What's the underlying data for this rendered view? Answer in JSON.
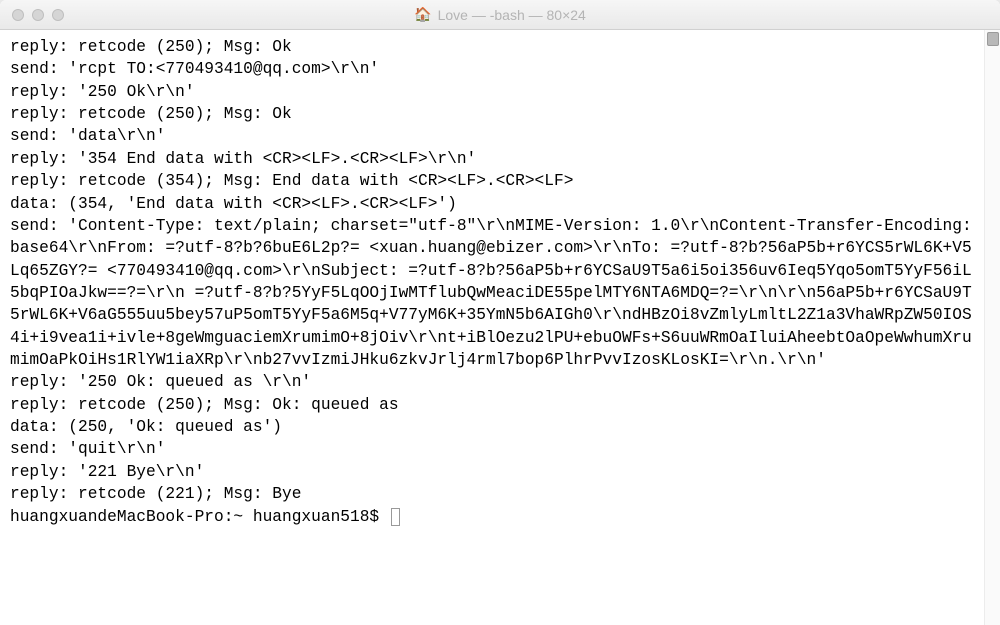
{
  "window": {
    "title": "Love — -bash — 80×24",
    "home_icon": "🏠"
  },
  "terminal": {
    "lines": [
      "reply: retcode (250); Msg: Ok",
      "send: 'rcpt TO:<770493410@qq.com>\\r\\n'",
      "reply: '250 Ok\\r\\n'",
      "reply: retcode (250); Msg: Ok",
      "send: 'data\\r\\n'",
      "reply: '354 End data with <CR><LF>.<CR><LF>\\r\\n'",
      "reply: retcode (354); Msg: End data with <CR><LF>.<CR><LF>",
      "data: (354, 'End data with <CR><LF>.<CR><LF>')",
      "send: 'Content-Type: text/plain; charset=\"utf-8\"\\r\\nMIME-Version: 1.0\\r\\nContent-Transfer-Encoding: base64\\r\\nFrom: =?utf-8?b?6buE6L2p?= <xuan.huang@ebizer.com>\\r\\nTo: =?utf-8?b?56aP5b+r6YCS5rWL6K+V5Lq65ZGY?= <770493410@qq.com>\\r\\nSubject: =?utf-8?b?56aP5b+r6YCSaU9T5a6i5oi356uv6Ieq5Yqo5omT5YyF56iL5bqPIOaJkw==?=\\r\\n =?utf-8?b?5YyF5LqOOjIwMTflubQwMeaciDE55pelMTY6NTA6MDQ=?=\\r\\n\\r\\n56aP5b+r6YCSaU9T5rWL6K+V6aG555uu5bey57uP5omT5YyF5a6M5q+V77yM6K+35YmN5b6AIGh0\\r\\ndHBzOi8vZmlyLmltL2Z1a3VhaWRpZW50IOS4i+i9vea1i+ivle+8geWmguaciemXrumimO+8jOiv\\r\\nt+iBlOezu2lPU+ebuOWFs+S6uuWRmOaIluiAheebtOaOpeWwhumXrumimOaPkOiHs1RlYW1iaXRp\\r\\nb27vvIzmiJHku6zkvJrlj4rml7bop6PlhrPvvIzosKLosKI=\\r\\n.\\r\\n'",
      "reply: '250 Ok: queued as \\r\\n'",
      "reply: retcode (250); Msg: Ok: queued as ",
      "data: (250, 'Ok: queued as')",
      "send: 'quit\\r\\n'",
      "reply: '221 Bye\\r\\n'",
      "reply: retcode (221); Msg: Bye"
    ],
    "prompt": "huangxuandeMacBook-Pro:~ huangxuan518$ "
  }
}
